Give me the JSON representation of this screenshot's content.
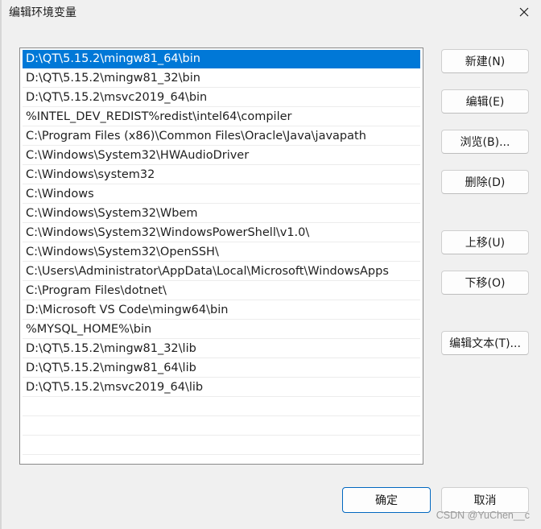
{
  "window": {
    "title": "编辑环境变量",
    "close_glyph": "✕"
  },
  "path_list": {
    "selected_index": 0,
    "items": [
      "D:\\QT\\5.15.2\\mingw81_64\\bin",
      "D:\\QT\\5.15.2\\mingw81_32\\bin",
      "D:\\QT\\5.15.2\\msvc2019_64\\bin",
      "%INTEL_DEV_REDIST%redist\\intel64\\compiler",
      "C:\\Program Files (x86)\\Common Files\\Oracle\\Java\\javapath",
      "C:\\Windows\\System32\\HWAudioDriver",
      "C:\\Windows\\system32",
      "C:\\Windows",
      "C:\\Windows\\System32\\Wbem",
      "C:\\Windows\\System32\\WindowsPowerShell\\v1.0\\",
      "C:\\Windows\\System32\\OpenSSH\\",
      "C:\\Users\\Administrator\\AppData\\Local\\Microsoft\\WindowsApps",
      "C:\\Program Files\\dotnet\\",
      "D:\\Microsoft VS Code\\mingw64\\bin",
      "%MYSQL_HOME%\\bin",
      "D:\\QT\\5.15.2\\mingw81_32\\lib",
      "D:\\QT\\5.15.2\\mingw81_64\\lib",
      "D:\\QT\\5.15.2\\msvc2019_64\\lib"
    ]
  },
  "buttons": {
    "new": "新建(N)",
    "edit": "编辑(E)",
    "browse": "浏览(B)...",
    "delete": "删除(D)",
    "move_up": "上移(U)",
    "move_down": "下移(O)",
    "edit_text": "编辑文本(T)...",
    "ok": "确定",
    "cancel": "取消"
  },
  "watermark": "CSDN @YuChen__c",
  "colors": {
    "selection": "#0078d7",
    "background": "#f0f0f0",
    "primary_border": "#0067c0"
  }
}
